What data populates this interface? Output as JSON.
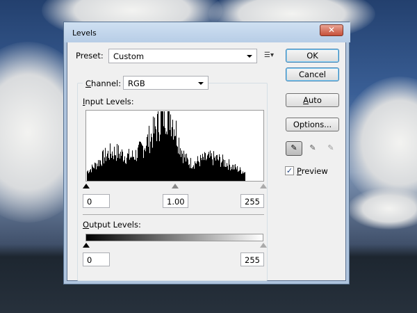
{
  "dialog": {
    "title": "Levels",
    "close_label": "X"
  },
  "preset": {
    "label": "Preset:",
    "value": "Custom"
  },
  "channel": {
    "label": "Channel:",
    "value": "RGB"
  },
  "input_levels": {
    "label": "Input Levels:",
    "black": "0",
    "gamma": "1.00",
    "white": "255"
  },
  "output_levels": {
    "label": "Output Levels:",
    "black": "0",
    "white": "255"
  },
  "buttons": {
    "ok": "OK",
    "cancel": "Cancel",
    "auto": "Auto",
    "options": "Options..."
  },
  "preview": {
    "label": "Preview",
    "checked": true
  }
}
